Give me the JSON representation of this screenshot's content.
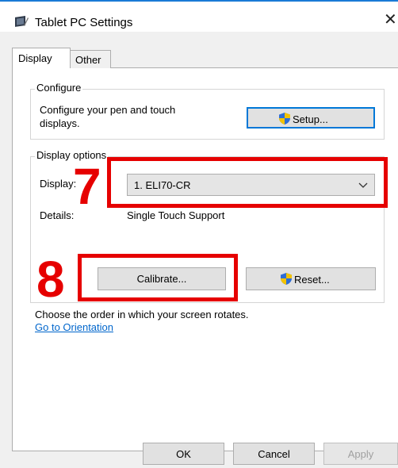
{
  "window": {
    "title": "Tablet PC Settings",
    "close_glyph": "✕"
  },
  "tabs": [
    {
      "label": "Display",
      "active": true
    },
    {
      "label": "Other",
      "active": false
    }
  ],
  "configure": {
    "group_label": "Configure",
    "description": "Configure your pen and touch displays.",
    "description_line1": "Configure your pen and touch",
    "description_line2": "displays.",
    "setup_button": "Setup..."
  },
  "display_options": {
    "group_label": "Display options",
    "display_label": "Display:",
    "display_value": "1. ELI70-CR",
    "details_label": "Details:",
    "details_value": "Single Touch Support",
    "calibrate_button": "Calibrate...",
    "reset_button": "Reset..."
  },
  "orientation": {
    "text": "Choose the order in which your screen rotates.",
    "link": "Go to Orientation"
  },
  "footer": {
    "ok": "OK",
    "cancel": "Cancel",
    "apply": "Apply"
  },
  "annotations": {
    "marker_7": "7",
    "marker_8": "8",
    "color": "#e60000"
  },
  "icons": [
    "tablet-settings-icon",
    "close-icon",
    "uac-shield-icon",
    "chevron-down-icon"
  ]
}
